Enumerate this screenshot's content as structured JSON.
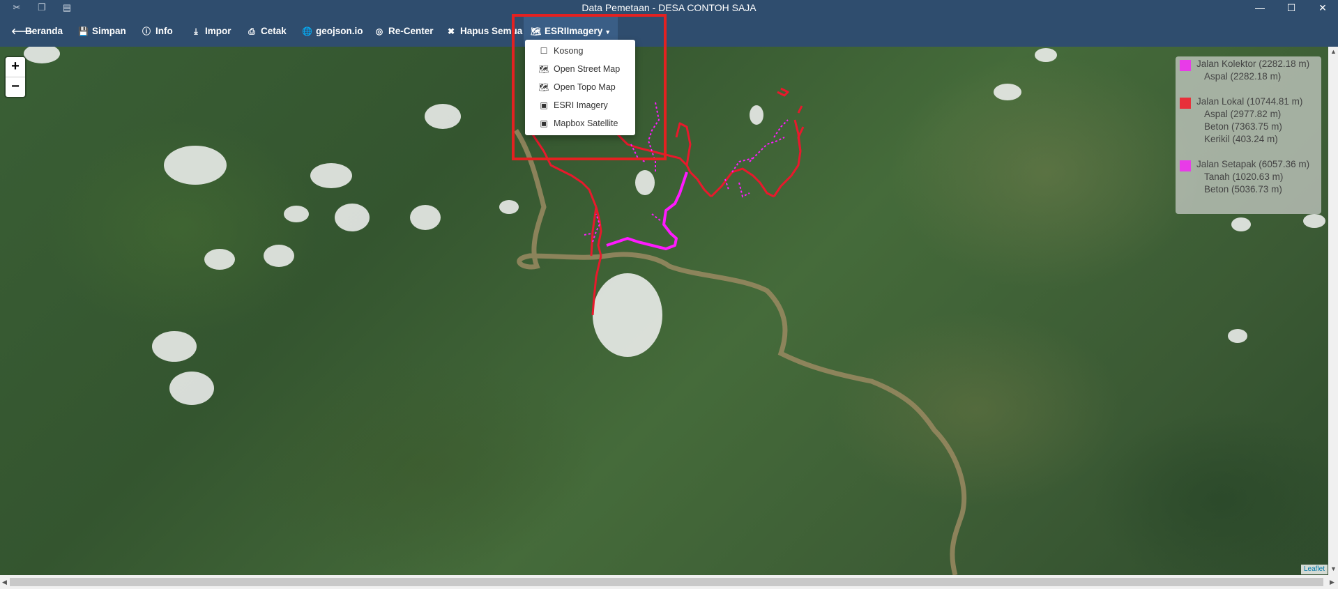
{
  "window": {
    "title": "Data Pemetaan - DESA CONTOH SAJA",
    "quick_icons": [
      "scissors-icon",
      "copy-icon",
      "paste-icon"
    ],
    "controls": [
      "minimize-icon",
      "maximize-icon",
      "close-icon"
    ]
  },
  "navbar": {
    "items": [
      {
        "label": "Beranda",
        "icon": "arrow-left-icon"
      },
      {
        "label": "Simpan",
        "icon": "save-icon"
      },
      {
        "label": "Info",
        "icon": "info-icon"
      },
      {
        "label": "Impor",
        "icon": "download-icon"
      },
      {
        "label": "Cetak",
        "icon": "print-icon"
      },
      {
        "label": "geojson.io",
        "icon": "globe-icon"
      },
      {
        "label": "Re-Center",
        "icon": "target-icon"
      },
      {
        "label": "Hapus Semua",
        "icon": "times-icon"
      }
    ],
    "basemap_button": {
      "label": "ESRIImagery",
      "icon": "map-icon"
    }
  },
  "basemap_menu": {
    "items": [
      {
        "label": "Kosong",
        "icon": "square-icon"
      },
      {
        "label": "Open Street Map",
        "icon": "map-icon"
      },
      {
        "label": "Open Topo Map",
        "icon": "map-icon"
      },
      {
        "label": "ESRI Imagery",
        "icon": "image-icon"
      },
      {
        "label": "Mapbox Satellite",
        "icon": "image-icon"
      }
    ]
  },
  "map": {
    "zoom_in": "+",
    "zoom_out": "−",
    "attribution": "Leaflet"
  },
  "legend": {
    "groups": [
      {
        "label": "Jalan Kolektor (2282.18 m)",
        "color": "#e83be8",
        "subs": [
          "Aspal (2282.18 m)"
        ]
      },
      {
        "label": "Jalan Lokal (10744.81 m)",
        "color": "#e8303a",
        "subs": [
          "Aspal (2977.82 m)",
          "Beton (7363.75 m)",
          "Kerikil (403.24 m)"
        ]
      },
      {
        "label": "Jalan Setapak (6057.36 m)",
        "color": "#e83be8",
        "subs": [
          "Tanah (1020.63 m)",
          "Beton (5036.73 m)"
        ]
      }
    ]
  },
  "colors": {
    "navbar": "#2f4d6e",
    "highlight_box": "#e42121",
    "road_red": "#e8192c",
    "road_magenta": "#ff1aff"
  }
}
